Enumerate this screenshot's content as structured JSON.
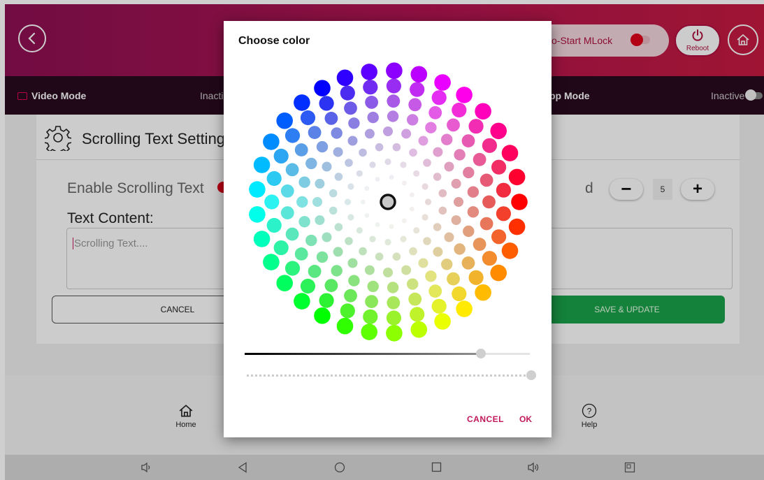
{
  "colors": {
    "accent": "#c2185b",
    "header_start": "#8e1053",
    "header_end": "#c71a40",
    "save_green": "#1aa34a",
    "toggle_red": "#e2001a"
  },
  "header": {
    "autostart_label": "o-Start MLock",
    "reboot_label": "Reboot"
  },
  "modebar": {
    "video_mode": "Video Mode",
    "video_status": "Inacti",
    "app_mode": "pp Mode",
    "app_status": "Inactive"
  },
  "card": {
    "title": "Scrolling Text Setting",
    "enable_label": "Enable Scrolling Text",
    "text_content_label": "Text Content:",
    "textarea_placeholder": "Scrolling Text....",
    "speed_label": "d",
    "speed_value": "5",
    "cancel_label": "CANCEL",
    "save_label": "SAVE & UPDATE"
  },
  "bottomnav": {
    "home": "Home",
    "help": "Help"
  },
  "dialog": {
    "title": "Choose color",
    "cancel": "CANCEL",
    "ok": "OK",
    "lightness": 0.83,
    "alpha": 1.0
  },
  "icons": [
    "back-arrow-icon",
    "power-icon",
    "home-icon",
    "video-icon",
    "gear-icon",
    "help-icon",
    "volume-down-icon",
    "nav-back-icon",
    "nav-home-icon",
    "nav-recents-icon",
    "volume-up-icon",
    "screenshot-icon"
  ]
}
